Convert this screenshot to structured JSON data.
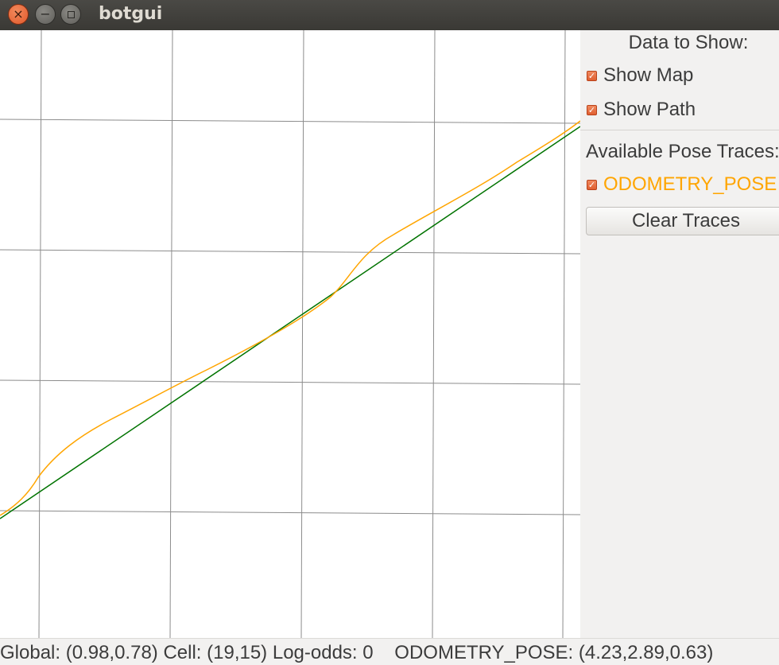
{
  "window": {
    "title": "botgui",
    "buttons": [
      {
        "name": "close",
        "icon": "close-icon",
        "glyph": "×"
      },
      {
        "name": "minimize",
        "icon": "minimize-icon",
        "glyph": "−"
      },
      {
        "name": "maximize",
        "icon": "maximize-icon",
        "glyph": ""
      }
    ]
  },
  "panel": {
    "data_heading": "Data to Show:",
    "show_map": {
      "label": "Show Map",
      "checked": true
    },
    "show_path": {
      "label": "Show Path",
      "checked": true
    },
    "traces_heading": "Available Pose Traces:",
    "traces": [
      {
        "label": "ODOMETRY_POSE",
        "checked": true,
        "color": "#ffa500"
      }
    ],
    "clear_button": "Clear Traces"
  },
  "status": {
    "text": "Global: (0.98,0.78) Cell: (19,15) Log-odds: 0    ODOMETRY_POSE: (4.23,2.89,0.63)"
  },
  "map": {
    "background": "#ffffff",
    "grid_color": "#8c8c8c",
    "path_color": "#007300",
    "trace_color": "#ffa500"
  }
}
